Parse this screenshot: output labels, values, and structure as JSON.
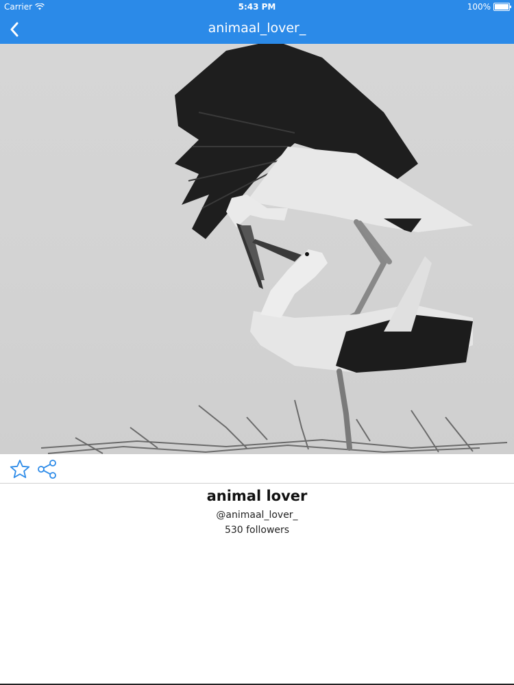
{
  "status_bar": {
    "carrier": "Carrier",
    "time": "5:43 PM",
    "battery": "100%",
    "battery_level": 1.0
  },
  "nav": {
    "title": "animaal_lover_",
    "back_icon": "chevron-left-icon"
  },
  "colors": {
    "accent": "#2b8ae8",
    "icon": "#2b8ae8",
    "photo_bg": "#d6d6d6"
  },
  "actions": {
    "star_icon": "star-outline-icon",
    "share_icon": "share-icon"
  },
  "profile": {
    "display_name": "animal lover",
    "handle": "@animaal_lover_",
    "followers": "530 followers"
  }
}
